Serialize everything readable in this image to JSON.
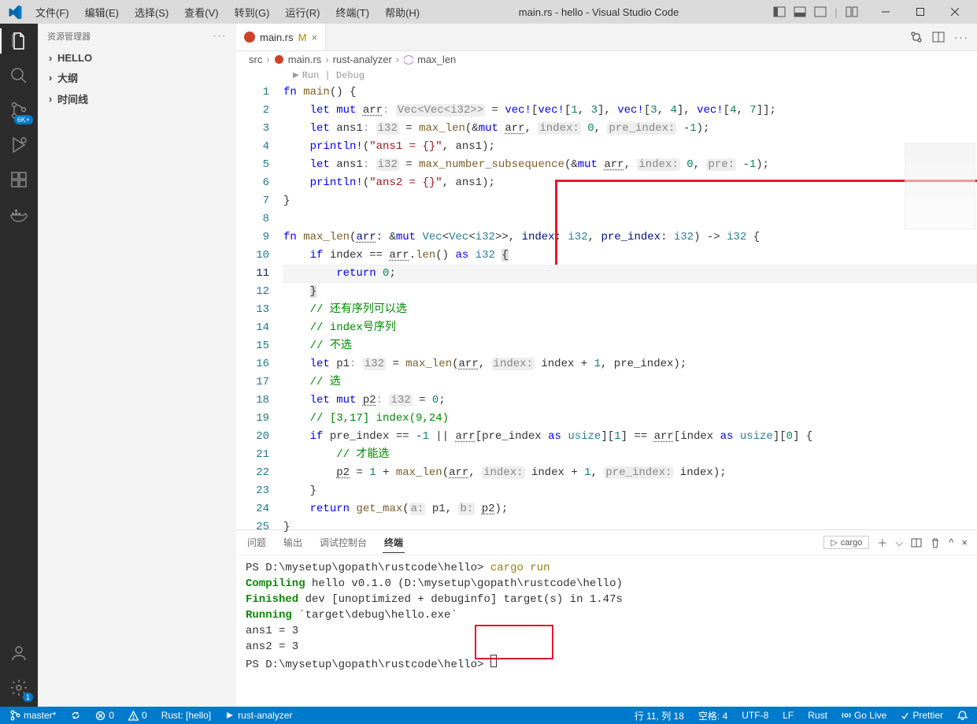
{
  "window_title": "main.rs - hello - Visual Studio Code",
  "menu": [
    "文件(F)",
    "编辑(E)",
    "选择(S)",
    "查看(V)",
    "转到(G)",
    "运行(R)",
    "终端(T)",
    "帮助(H)"
  ],
  "side": {
    "title": "资源管理器",
    "sections": [
      "HELLO",
      "大纲",
      "时间线"
    ]
  },
  "tab": {
    "name": "main.rs",
    "modified": "M"
  },
  "breadcrumbs": {
    "a": "src",
    "b": "main.rs",
    "c": "rust-analyzer",
    "d": "max_len"
  },
  "codelens": "Run | Debug",
  "code": {
    "l1": "fn main() {",
    "l2": "    let mut arr: Vec<Vec<i32>> = vec![vec![1, 3], vec![3, 4], vec![4, 7]];",
    "l3": "    let ans1: i32 = max_len(&mut arr, index: 0, pre_index: -1);",
    "l4": "    println!(\"ans1 = {}\", ans1);",
    "l5": "    let ans1: i32 = max_number_subsequence(&mut arr, index: 0, pre: -1);",
    "l6": "    println!(\"ans2 = {}\", ans1);",
    "l7": "}",
    "l8": "",
    "l9": "fn max_len(arr: &mut Vec<Vec<i32>>, index: i32, pre_index: i32) -> i32 {",
    "l10": "    if index == arr.len() as i32 {",
    "l11": "        return 0;",
    "l12": "    }",
    "l13": "    // 还有序列可以选",
    "l14": "    // index号序列",
    "l15": "    // 不选",
    "l16": "    let p1: i32 = max_len(arr, index: index + 1, pre_index);",
    "l17": "    // 选",
    "l18": "    let mut p2: i32 = 0;",
    "l19": "    // [3,17] index(9,24)",
    "l20": "    if pre_index == -1 || arr[pre_index as usize][1] == arr[index as usize][0] {",
    "l21": "        // 才能选",
    "l22": "        p2 = 1 + max_len(arr, index: index + 1, pre_index: index);",
    "l23": "    }",
    "l24": "    return get_max(a: p1, b: p2);",
    "l25": "}"
  },
  "panel": {
    "tabs": [
      "问题",
      "输出",
      "调试控制台",
      "终端"
    ],
    "active": 3,
    "cargo": "cargo"
  },
  "terminal": {
    "l1": "PS D:\\mysetup\\gopath\\rustcode\\hello> cargo run",
    "l1cmd": "cargo run",
    "l1ps": "PS D:\\mysetup\\gopath\\rustcode\\hello> ",
    "l2a": "   Compiling",
    "l2b": " hello v0.1.0 (D:\\mysetup\\gopath\\rustcode\\hello)",
    "l3a": "    Finished",
    "l3b": " dev [unoptimized + debuginfo] target(s) in 1.47s",
    "l4a": "     Running",
    "l4b": " `target\\debug\\hello.exe`",
    "l5": "ans1 = 3",
    "l6": "ans2 = 3",
    "l7": "PS D:\\mysetup\\gopath\\rustcode\\hello> "
  },
  "status": {
    "branch": "master*",
    "sync": "",
    "errors": "0",
    "warnings": "0",
    "rust_proj": "Rust: [hello]",
    "rust_analyzer": "rust-analyzer",
    "line_col": "行 11, 列 18",
    "spaces": "空格: 4",
    "encoding": "UTF-8",
    "eol": "LF",
    "lang": "Rust",
    "golive": "Go Live",
    "prettier": "Prettier"
  },
  "activity_badge": "6K+",
  "settings_badge": "1"
}
